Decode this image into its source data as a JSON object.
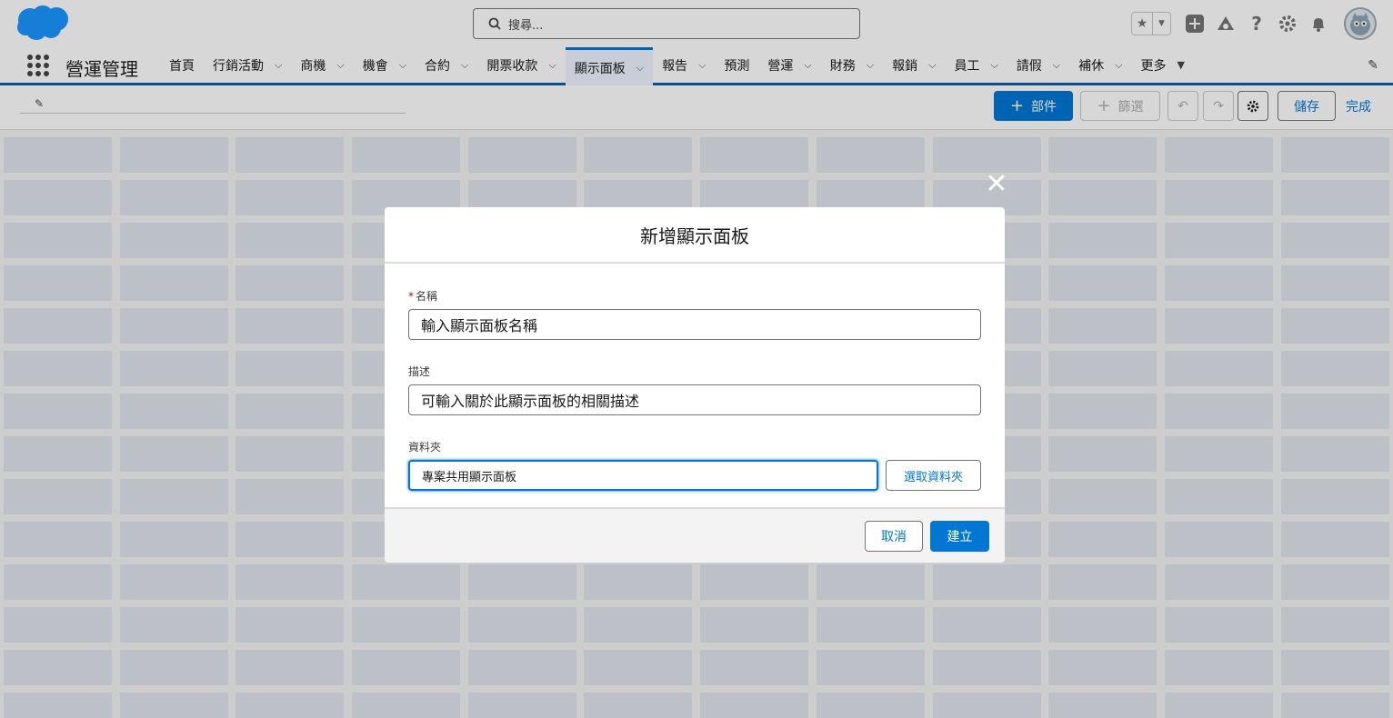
{
  "header": {
    "search_placeholder": "搜尋...",
    "icons": [
      "salesforce-cloud-logo",
      "star-icon",
      "chevron-down-icon",
      "plus-icon",
      "trailhead-icon",
      "help-icon",
      "gear-icon",
      "bell-icon",
      "avatar"
    ]
  },
  "nav": {
    "app_name": "營運管理",
    "tabs": [
      {
        "label": "首頁",
        "has_menu": false
      },
      {
        "label": "行銷活動",
        "has_menu": true
      },
      {
        "label": "商機",
        "has_menu": true
      },
      {
        "label": "機會",
        "has_menu": true
      },
      {
        "label": "合約",
        "has_menu": true
      },
      {
        "label": "開票收款",
        "has_menu": true
      },
      {
        "label": "顯示面板",
        "has_menu": true,
        "active": true
      },
      {
        "label": "報告",
        "has_menu": true
      },
      {
        "label": "預測",
        "has_menu": false
      },
      {
        "label": "營運",
        "has_menu": true
      },
      {
        "label": "財務",
        "has_menu": true
      },
      {
        "label": "報銷",
        "has_menu": true
      },
      {
        "label": "員工",
        "has_menu": true
      },
      {
        "label": "請假",
        "has_menu": true
      },
      {
        "label": "補休",
        "has_menu": true
      },
      {
        "label": "更多",
        "has_menu": true
      }
    ]
  },
  "toolbar": {
    "add_component": "部件",
    "filter": "篩選",
    "save": "儲存",
    "done": "完成"
  },
  "modal": {
    "title": "新增顯示面板",
    "name_label": "名稱",
    "name_required": "*",
    "name_value": "輸入顯示面板名稱",
    "description_label": "描述",
    "description_value": "可輸入關於此顯示面板的相關描述",
    "folder_label": "資料夾",
    "folder_value": "專案共用顯示面板",
    "select_folder": "選取資料夾",
    "cancel": "取消",
    "create": "建立"
  },
  "colors": {
    "brand_blue": "#0176d3",
    "nav_underline": "#0b5cab",
    "required_red": "#ba0517"
  }
}
